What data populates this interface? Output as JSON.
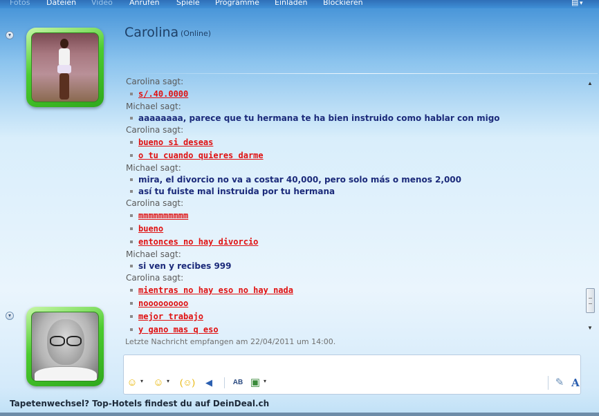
{
  "menu": {
    "items": [
      {
        "label": "Fotos",
        "enabled": false
      },
      {
        "label": "Dateien",
        "enabled": true
      },
      {
        "label": "Video",
        "enabled": false
      },
      {
        "label": "Anrufen",
        "enabled": true
      },
      {
        "label": "Spiele",
        "enabled": true
      },
      {
        "label": "Programme",
        "enabled": true
      },
      {
        "label": "Einladen",
        "enabled": true
      },
      {
        "label": "Blockieren",
        "enabled": true
      }
    ],
    "options_icon": "menu-options-icon"
  },
  "header": {
    "contact_name": "Carolina",
    "contact_status": "(Online)"
  },
  "conversation": {
    "messages": [
      {
        "speaker": "Carolina sagt:",
        "who": "carolina",
        "lines": [
          "s/.40.0000"
        ]
      },
      {
        "speaker": "Michael sagt:",
        "who": "michael",
        "lines": [
          "aaaaaaaa, parece que tu hermana te ha bien instruido como hablar con migo"
        ]
      },
      {
        "speaker": "Carolina sagt:",
        "who": "carolina",
        "lines": [
          "bueno si deseas",
          "o tu cuando quieres darme"
        ]
      },
      {
        "speaker": "Michael sagt:",
        "who": "michael",
        "lines": [
          "mira, el divorcio no va a costar 40,000, pero solo más o menos 2,000",
          "así tu fuiste mal instruida por tu hermana"
        ]
      },
      {
        "speaker": "Carolina sagt:",
        "who": "carolina",
        "lines": [
          "mmmmmmmmmm",
          "bueno",
          "entonces no hay divorcio"
        ]
      },
      {
        "speaker": "Michael sagt:",
        "who": "michael",
        "lines": [
          "si ven y recibes 999"
        ]
      },
      {
        "speaker": "Carolina sagt:",
        "who": "carolina",
        "lines": [
          "mientras no hay eso no hay nada",
          "nooooooooo",
          "mejor trabajo",
          "y gano mas q eso"
        ]
      }
    ],
    "last_message": "Letzte Nachricht empfangen am 22/04/2011 um 14:00."
  },
  "toolbar": {
    "buttons": [
      "emoticon-icon",
      "wink-icon",
      "nudge-icon",
      "voice-clip-icon",
      "spell-check-icon",
      "background-icon",
      "handwriting-pen-icon",
      "font-icon"
    ],
    "emoticon_glyph": "☺",
    "wink_glyph": "☺",
    "nudge_glyph": "(☺)",
    "voice_glyph": "◀",
    "spell_glyph": "AB",
    "background_glyph": "▣",
    "pen_glyph": "✎",
    "font_glyph": "A"
  },
  "ad": {
    "text": "Tapetenwechsel? Top-Hotels findest du auf DeinDeal.ch"
  },
  "colors": {
    "michael_text": "#1b2a7a",
    "carolina_text": "#e01010",
    "speaker_text": "#595959",
    "avatar_frame": "#4ccc2f"
  }
}
